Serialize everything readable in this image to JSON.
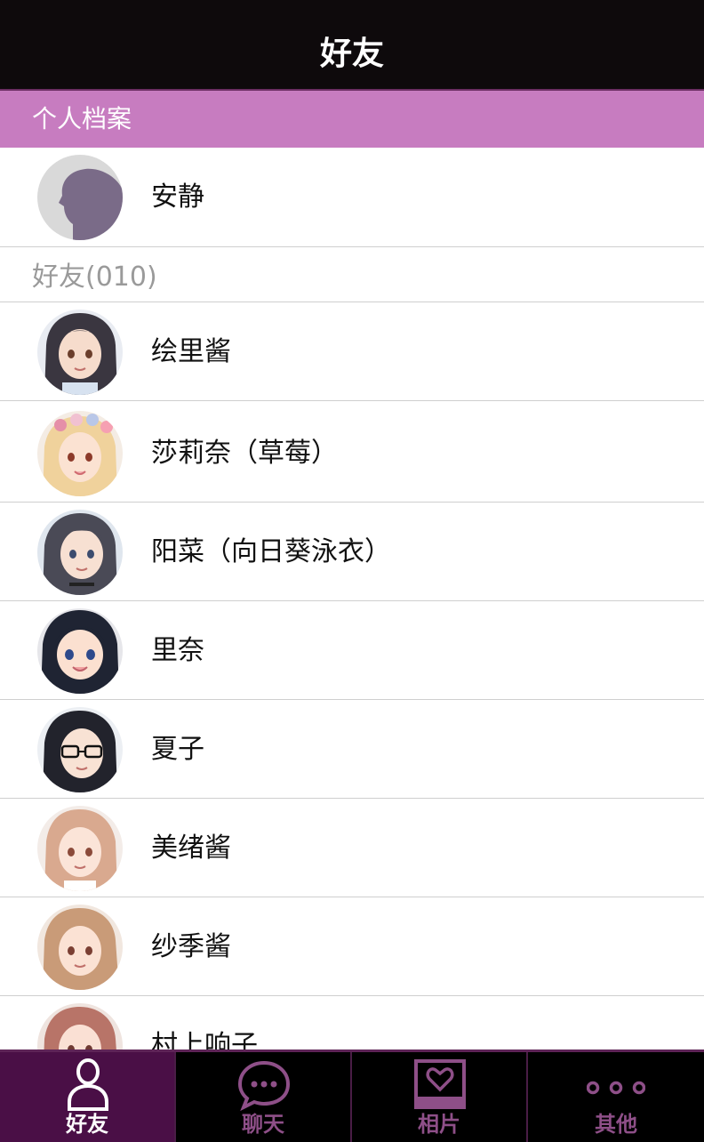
{
  "header": {
    "title": "好友"
  },
  "profile_section": {
    "label": "个人档案",
    "me": {
      "name": "安静",
      "avatar": "silhouette-avatar"
    }
  },
  "friends_section": {
    "label": "好友(010)",
    "items": [
      {
        "name": "绘里酱"
      },
      {
        "name": "莎莉奈（草莓）"
      },
      {
        "name": "阳菜（向日葵泳衣）"
      },
      {
        "name": "里奈"
      },
      {
        "name": "夏子"
      },
      {
        "name": "美绪酱"
      },
      {
        "name": "纱季酱"
      },
      {
        "name": "村上响子"
      }
    ]
  },
  "tabbar": {
    "tabs": [
      {
        "label": "好友",
        "icon": "person-icon",
        "active": true
      },
      {
        "label": "聊天",
        "icon": "chat-bubble-icon",
        "active": false
      },
      {
        "label": "相片",
        "icon": "photo-heart-icon",
        "active": false
      },
      {
        "label": "其他",
        "icon": "more-dots-icon",
        "active": false
      }
    ]
  },
  "colors": {
    "header_bg": "#0e0a0c",
    "section_bar": "#c77cc0",
    "tab_active_bg": "#4a0f46",
    "tab_active_fg": "#ffffff",
    "tab_inactive_fg": "#8e4f88"
  }
}
